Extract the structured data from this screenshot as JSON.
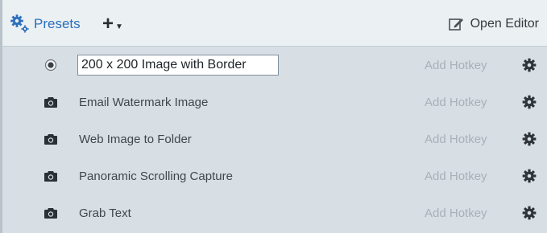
{
  "header": {
    "presets_label": "Presets",
    "add_label": "+",
    "open_editor_label": "Open Editor"
  },
  "presets": [
    {
      "name": "200 x 200 Image with Border",
      "hotkey": "Add Hotkey",
      "icon": "radio-selected-icon",
      "editing": true
    },
    {
      "name": "Email Watermark Image",
      "hotkey": "Add Hotkey",
      "icon": "camera-icon",
      "editing": false
    },
    {
      "name": "Web Image to Folder",
      "hotkey": "Add Hotkey",
      "icon": "camera-icon",
      "editing": false
    },
    {
      "name": "Panoramic Scrolling Capture",
      "hotkey": "Add Hotkey",
      "icon": "camera-icon",
      "editing": false
    },
    {
      "name": "Grab Text",
      "hotkey": "Add Hotkey",
      "icon": "camera-icon",
      "editing": false
    }
  ],
  "colors": {
    "accent": "#2c6fbb",
    "panel_bg": "#d8dfe4",
    "header_bg": "#ebf0f3",
    "hotkey_text": "#a7b0b8"
  }
}
